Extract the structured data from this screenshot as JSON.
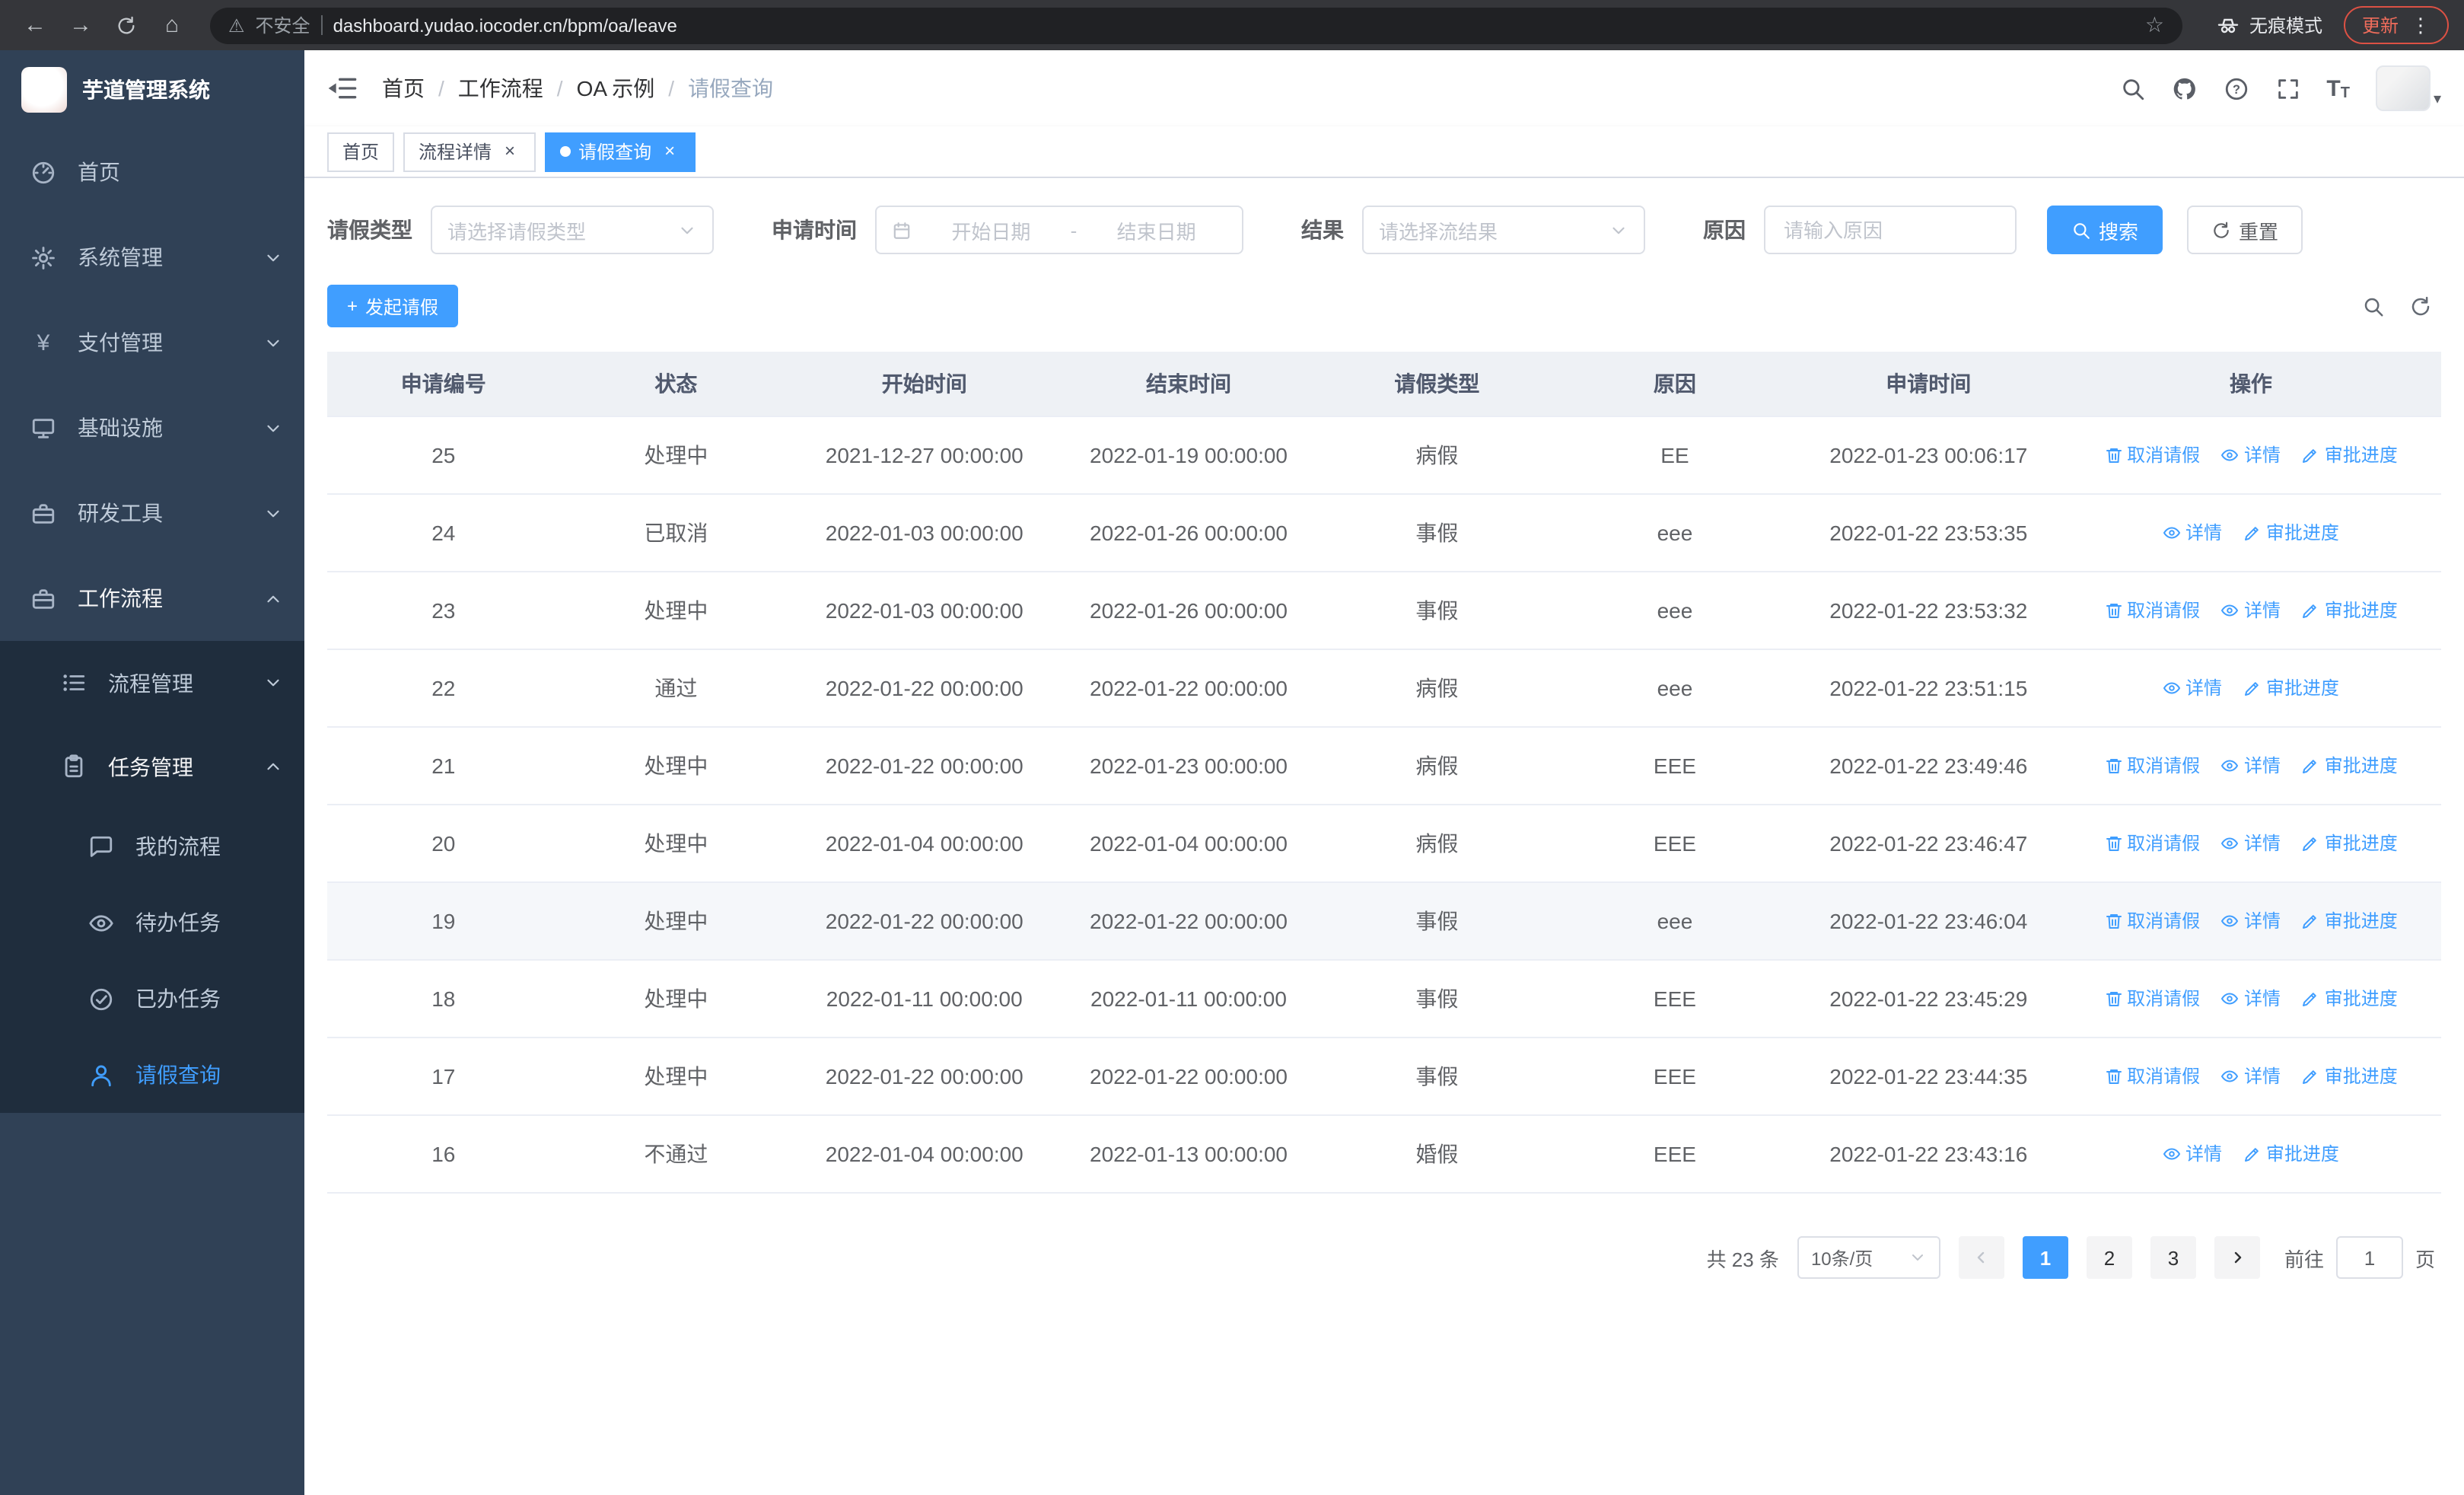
{
  "theme": {
    "primary": "#409eff",
    "sidebar_bg": "#304156",
    "sidebar_sub_bg": "#1f2d3d"
  },
  "browser": {
    "security_warning": "不安全",
    "url": "dashboard.yudao.iocoder.cn/bpm/oa/leave",
    "incognito_label": "无痕模式",
    "update_label": "更新"
  },
  "sidebar": {
    "logo_title": "芋道管理系统",
    "items": [
      {
        "label": "首页"
      },
      {
        "label": "系统管理"
      },
      {
        "label": "支付管理"
      },
      {
        "label": "基础设施"
      },
      {
        "label": "研发工具"
      },
      {
        "label": "工作流程"
      }
    ],
    "submenu": [
      {
        "label": "流程管理"
      },
      {
        "label": "任务管理"
      }
    ],
    "task_children": [
      {
        "label": "我的流程"
      },
      {
        "label": "待办任务"
      },
      {
        "label": "已办任务"
      },
      {
        "label": "请假查询"
      }
    ]
  },
  "navbar": {
    "breadcrumb": [
      "首页",
      "工作流程",
      "OA 示例",
      "请假查询"
    ]
  },
  "tabs": [
    {
      "label": "首页"
    },
    {
      "label": "流程详情"
    },
    {
      "label": "请假查询"
    }
  ],
  "filters": {
    "leave_type_label": "请假类型",
    "leave_type_placeholder": "请选择请假类型",
    "apply_time_label": "申请时间",
    "start_date_placeholder": "开始日期",
    "range_separator": "-",
    "end_date_placeholder": "结束日期",
    "result_label": "结果",
    "result_placeholder": "请选择流结果",
    "reason_label": "原因",
    "reason_placeholder": "请输入原因",
    "search_button": "搜索",
    "reset_button": "重置"
  },
  "toolbar": {
    "create_button": "发起请假"
  },
  "table": {
    "headers": [
      "申请编号",
      "状态",
      "开始时间",
      "结束时间",
      "请假类型",
      "原因",
      "申请时间",
      "操作"
    ],
    "actions": {
      "cancel": "取消请假",
      "detail": "详情",
      "progress": "审批进度"
    },
    "rows": [
      {
        "id": "25",
        "status": "处理中",
        "start": "2021-12-27 00:00:00",
        "end": "2022-01-19 00:00:00",
        "type": "病假",
        "reason": "EE",
        "applied": "2022-01-23 00:06:17",
        "cancellable": true,
        "hover": false
      },
      {
        "id": "24",
        "status": "已取消",
        "start": "2022-01-03 00:00:00",
        "end": "2022-01-26 00:00:00",
        "type": "事假",
        "reason": "eee",
        "applied": "2022-01-22 23:53:35",
        "cancellable": false,
        "hover": false
      },
      {
        "id": "23",
        "status": "处理中",
        "start": "2022-01-03 00:00:00",
        "end": "2022-01-26 00:00:00",
        "type": "事假",
        "reason": "eee",
        "applied": "2022-01-22 23:53:32",
        "cancellable": true,
        "hover": false
      },
      {
        "id": "22",
        "status": "通过",
        "start": "2022-01-22 00:00:00",
        "end": "2022-01-22 00:00:00",
        "type": "病假",
        "reason": "eee",
        "applied": "2022-01-22 23:51:15",
        "cancellable": false,
        "hover": false
      },
      {
        "id": "21",
        "status": "处理中",
        "start": "2022-01-22 00:00:00",
        "end": "2022-01-23 00:00:00",
        "type": "病假",
        "reason": "EEE",
        "applied": "2022-01-22 23:49:46",
        "cancellable": true,
        "hover": false
      },
      {
        "id": "20",
        "status": "处理中",
        "start": "2022-01-04 00:00:00",
        "end": "2022-01-04 00:00:00",
        "type": "病假",
        "reason": "EEE",
        "applied": "2022-01-22 23:46:47",
        "cancellable": true,
        "hover": false
      },
      {
        "id": "19",
        "status": "处理中",
        "start": "2022-01-22 00:00:00",
        "end": "2022-01-22 00:00:00",
        "type": "事假",
        "reason": "eee",
        "applied": "2022-01-22 23:46:04",
        "cancellable": true,
        "hover": true
      },
      {
        "id": "18",
        "status": "处理中",
        "start": "2022-01-11 00:00:00",
        "end": "2022-01-11 00:00:00",
        "type": "事假",
        "reason": "EEE",
        "applied": "2022-01-22 23:45:29",
        "cancellable": true,
        "hover": false
      },
      {
        "id": "17",
        "status": "处理中",
        "start": "2022-01-22 00:00:00",
        "end": "2022-01-22 00:00:00",
        "type": "事假",
        "reason": "EEE",
        "applied": "2022-01-22 23:44:35",
        "cancellable": true,
        "hover": false
      },
      {
        "id": "16",
        "status": "不通过",
        "start": "2022-01-04 00:00:00",
        "end": "2022-01-13 00:00:00",
        "type": "婚假",
        "reason": "EEE",
        "applied": "2022-01-22 23:43:16",
        "cancellable": false,
        "hover": false
      }
    ]
  },
  "pagination": {
    "total_text": "共 23 条",
    "page_size": "10条/页",
    "pages": [
      "1",
      "2",
      "3"
    ],
    "goto_label": "前往",
    "goto_value": "1",
    "goto_suffix": "页"
  }
}
